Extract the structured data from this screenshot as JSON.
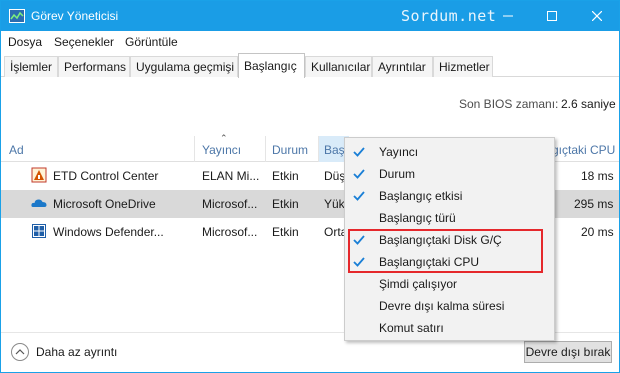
{
  "window": {
    "title": "Görev Yöneticisi",
    "watermark": "Sordum.net"
  },
  "menu": [
    "Dosya",
    "Seçenekler",
    "Görüntüle"
  ],
  "tabs": [
    "İşlemler",
    "Performans",
    "Uygulama geçmişi",
    "Başlangıç",
    "Kullanıcılar",
    "Ayrıntılar",
    "Hizmetler"
  ],
  "active_tab": "Başlangıç",
  "bios": {
    "label": "Son BIOS zamanı:",
    "value": "2.6 saniye"
  },
  "columns": {
    "name": "Ad",
    "publisher": "Yayıncı",
    "status": "Durum",
    "impact_partial": "Başl",
    "cpu_partial": "gıçtaki CPU"
  },
  "rows": [
    {
      "name": "ETD Control Center",
      "publisher": "ELAN Mi...",
      "status": "Etkin",
      "impact": "Düş",
      "cpu": "18 ms",
      "icon": "etd-app-icon"
    },
    {
      "name": "Microsoft OneDrive",
      "publisher": "Microsof...",
      "status": "Etkin",
      "impact": "Yük",
      "cpu": "295 ms",
      "icon": "onedrive-cloud-icon"
    },
    {
      "name": "Windows Defender...",
      "publisher": "Microsof...",
      "status": "Etkin",
      "impact": "Orta",
      "cpu": "20 ms",
      "icon": "windows-defender-icon"
    }
  ],
  "context_menu": [
    {
      "label": "Yayıncı",
      "checked": true
    },
    {
      "label": "Durum",
      "checked": true
    },
    {
      "label": "Başlangıç etkisi",
      "checked": true
    },
    {
      "label": "Başlangıç türü",
      "checked": false
    },
    {
      "label": "Başlangıçtaki Disk G/Ç",
      "checked": true
    },
    {
      "label": "Başlangıçtaki CPU",
      "checked": true
    },
    {
      "label": "Şimdi çalışıyor",
      "checked": false
    },
    {
      "label": "Devre dışı kalma süresi",
      "checked": false
    },
    {
      "label": "Komut satırı",
      "checked": false
    }
  ],
  "footer": {
    "less_details": "Daha az ayrıntı",
    "disable_button": "Devre dışı bırak"
  },
  "colors": {
    "titlebar": "#1a9de6",
    "check": "#1a7fd6",
    "highlight": "#e5282c"
  }
}
